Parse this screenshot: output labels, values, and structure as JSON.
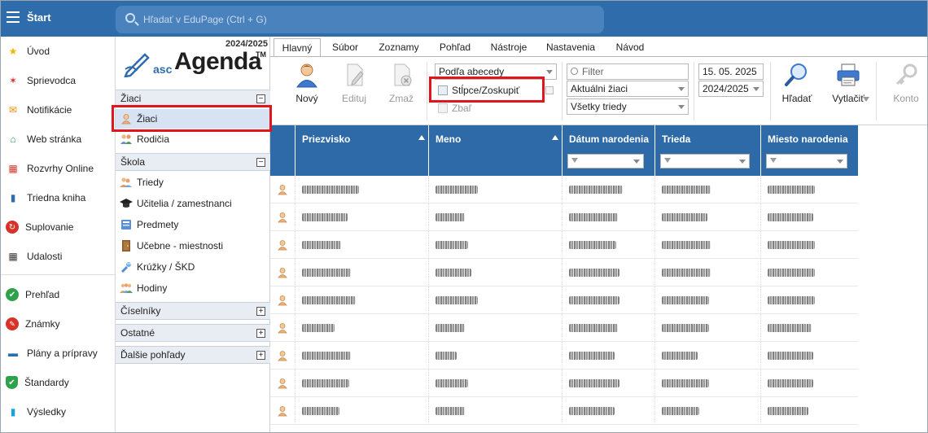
{
  "topbar": {
    "start_label": "Štart",
    "search_placeholder": "Hľadať v EduPage (Ctrl + G)"
  },
  "leftnav": {
    "items": [
      {
        "label": "Úvod",
        "icon": "star-icon",
        "color": "#f2b705"
      },
      {
        "label": "Sprievodca",
        "icon": "magic-wand-icon",
        "color": "#d8332a"
      },
      {
        "label": "Notifikácie",
        "icon": "envelope-icon",
        "color": "#f08a00"
      },
      {
        "label": "Web stránka",
        "icon": "home-icon",
        "color": "#2a9a4a"
      },
      {
        "label": "Rozvrhy Online",
        "icon": "timetable-icon",
        "color": "#d8332a"
      },
      {
        "label": "Triedna kniha",
        "icon": "book-icon",
        "color": "#2f6cab"
      },
      {
        "label": "Suplovanie",
        "icon": "substitution-icon",
        "color": "#d8332a"
      },
      {
        "label": "Udalosti",
        "icon": "calendar-icon",
        "color": "#333333"
      },
      {
        "label": "Prehľad",
        "icon": "check-circle-icon",
        "color": "#2ea24a"
      },
      {
        "label": "Známky",
        "icon": "grades-icon",
        "color": "#d8332a"
      },
      {
        "label": "Plány a prípravy",
        "icon": "briefcase-icon",
        "color": "#2f6cab"
      },
      {
        "label": "Štandardy",
        "icon": "shield-check-icon",
        "color": "#2ea24a"
      },
      {
        "label": "Výsledky",
        "icon": "bar-chart-icon",
        "color": "#1aa3d8"
      }
    ]
  },
  "agenda": {
    "year": "2024/2025",
    "logo_small": "asc",
    "logo_main": "Agenda",
    "logo_tm": "TM",
    "sections": [
      {
        "label": "Žiaci",
        "toggle": "−"
      },
      {
        "label": "Škola",
        "toggle": "−"
      },
      {
        "label": "Číselníky",
        "toggle": "+"
      },
      {
        "label": "Ostatné",
        "toggle": "+"
      },
      {
        "label": "Ďalšie pohľady",
        "toggle": "+"
      }
    ],
    "ziaci_items": [
      {
        "label": "Žiaci",
        "icon": "student-icon"
      },
      {
        "label": "Rodičia",
        "icon": "parents-icon"
      }
    ],
    "skola_items": [
      {
        "label": "Triedy",
        "icon": "class-icon"
      },
      {
        "label": "Učitelia / zamestnanci",
        "icon": "graduation-cap-icon"
      },
      {
        "label": "Predmety",
        "icon": "subject-icon"
      },
      {
        "label": "Učebne - miestnosti",
        "icon": "door-icon"
      },
      {
        "label": "Krúžky / ŠKD",
        "icon": "puzzle-icon"
      },
      {
        "label": "Hodiny",
        "icon": "lessons-icon"
      }
    ]
  },
  "ribbon": {
    "tabs": [
      "Hlavný",
      "Súbor",
      "Zoznamy",
      "Pohľad",
      "Nástroje",
      "Nastavenia",
      "Návod"
    ],
    "new_label": "Nový",
    "edit_label": "Edituj",
    "delete_label": "Zmaž",
    "sort_select": "Podľa abecedy",
    "columns_group_label": "Stĺpce/Zoskupiť",
    "collapse_label": "Zbaľ",
    "filter_placeholder": "Filter",
    "students_select": "Aktuálni žiaci",
    "classes_select": "Všetky triedy",
    "date_value": "15. 05. 2025",
    "year_select": "2024/2025",
    "search_label": "Hľadať",
    "print_label": "Vytlačiť",
    "account_label": "Konto"
  },
  "grid": {
    "columns": [
      "Priezvisko",
      "Meno",
      "Dátum narodenia",
      "Trieda",
      "Miesto narodenia"
    ],
    "row_count": 9
  }
}
